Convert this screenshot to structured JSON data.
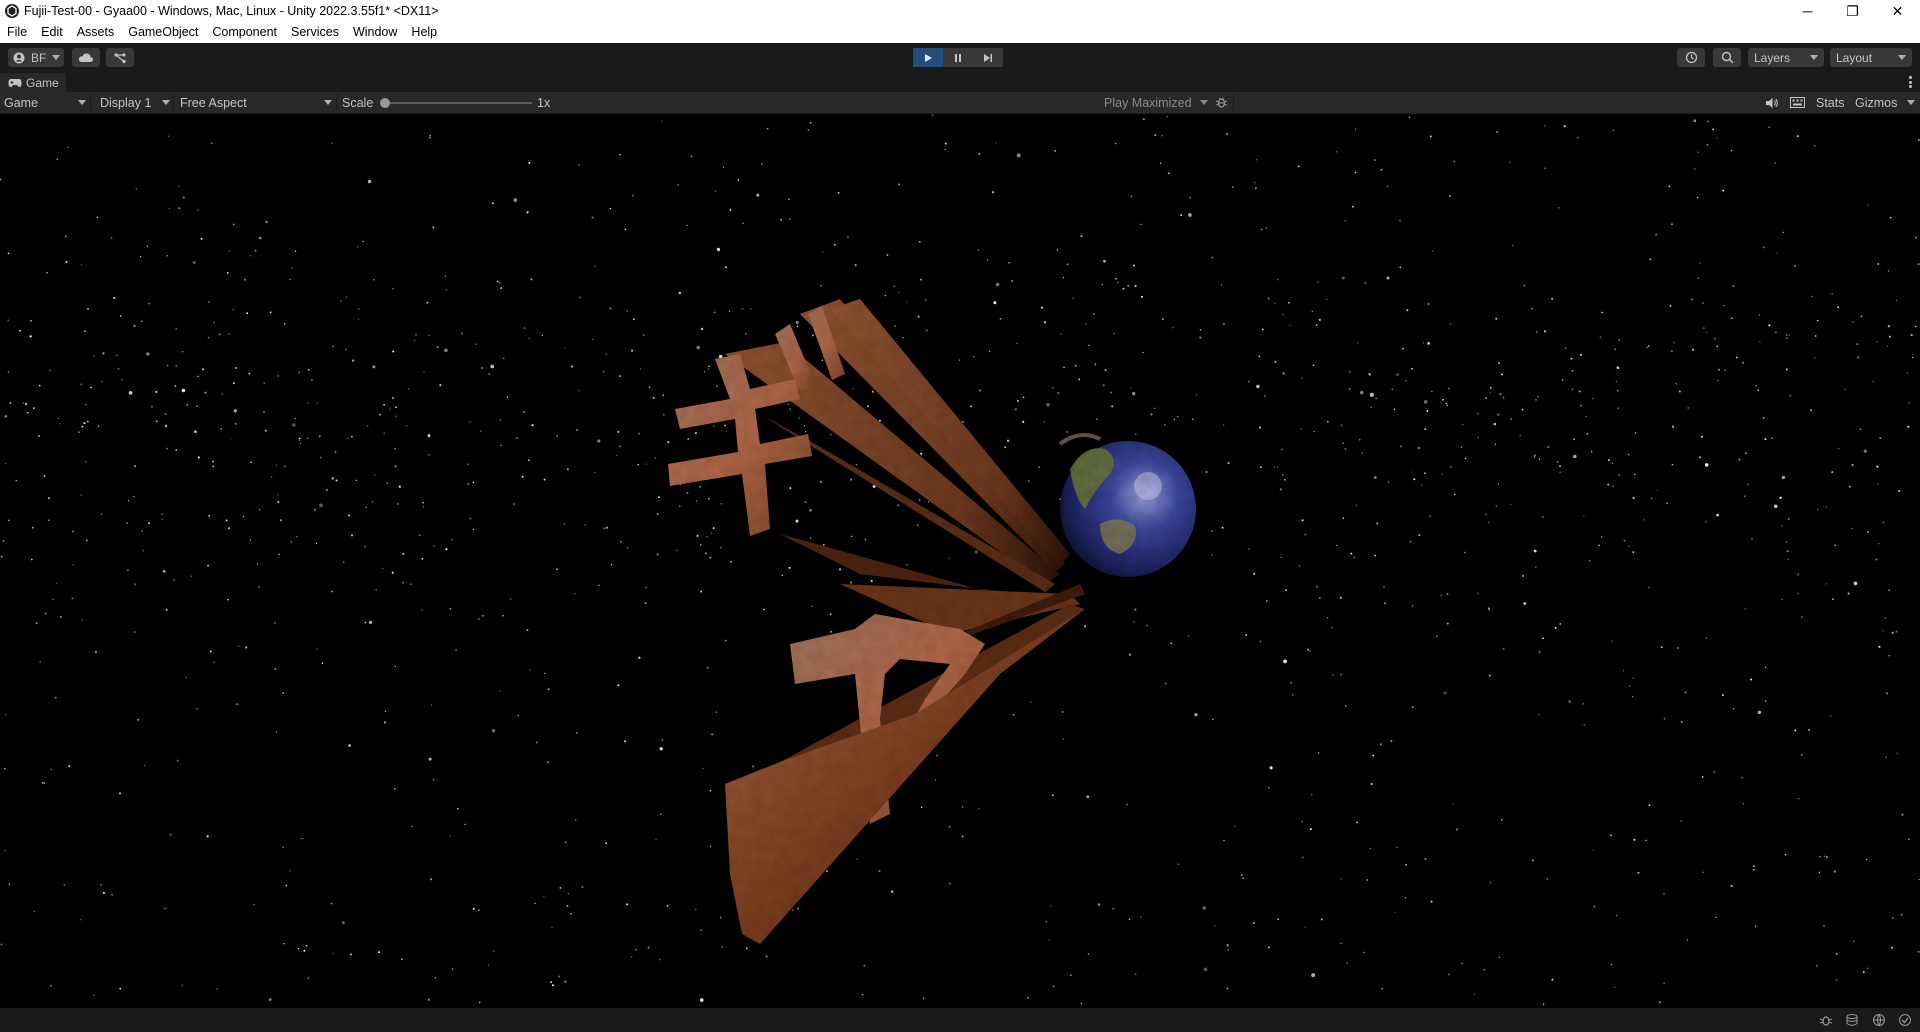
{
  "window": {
    "title": "Fujii-Test-00 - Gyaa00 - Windows, Mac, Linux - Unity 2022.3.55f1* <DX11>",
    "controls": {
      "minimize": "─",
      "restore": "❐",
      "close": "✕"
    }
  },
  "menu": [
    "File",
    "Edit",
    "Assets",
    "GameObject",
    "Component",
    "Services",
    "Window",
    "Help"
  ],
  "toolbar": {
    "account_label": "BF",
    "layers_label": "Layers",
    "layout_label": "Layout",
    "play_state": "playing"
  },
  "tab": {
    "label": "Game"
  },
  "game_view": {
    "mode": "Game",
    "display": "Display 1",
    "aspect": "Free Aspect",
    "scale_label": "Scale",
    "scale_value": "1x",
    "play_mode": "Play Maximized",
    "stats_label": "Stats",
    "gizmos_label": "Gizmos"
  },
  "scene": {
    "background": "#000000",
    "text_characters": [
      "ギ",
      "ャ",
      "ア"
    ],
    "material_color": "#8a4a2a",
    "earth_color": "#2a3a8a"
  },
  "colors": {
    "accent_play": "#264e7a",
    "panel_dark": "#191919",
    "panel_mid": "#282828",
    "button": "#383838",
    "text_light": "#c4c4c4"
  }
}
